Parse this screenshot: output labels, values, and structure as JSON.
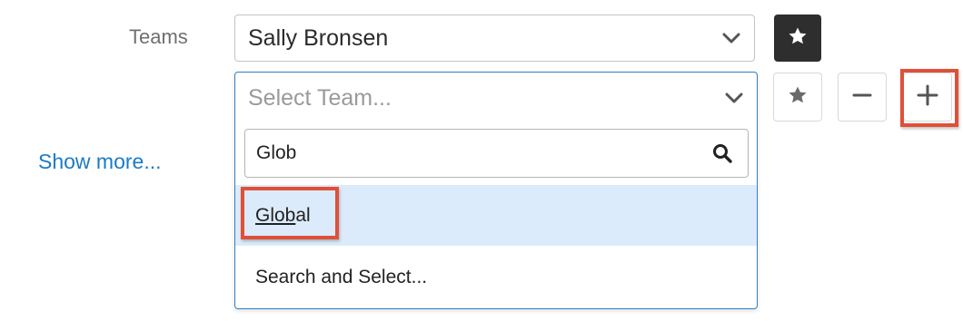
{
  "field": {
    "label": "Teams"
  },
  "primary_team": {
    "value": "Sally Bronsen"
  },
  "team_select": {
    "placeholder": "Select Team...",
    "search": {
      "value": "Glob",
      "placeholder": ""
    },
    "results": [
      {
        "match": "Glob",
        "rest": "al",
        "highlighted": true
      },
      {
        "label": "Search and Select..."
      }
    ]
  },
  "show_more": {
    "label": "Show more..."
  },
  "icons": {
    "primary_star": "star-icon",
    "row_star": "star-icon",
    "remove": "minus-icon",
    "add": "plus-icon",
    "search": "search-icon",
    "dropdown": "chevron-down-icon"
  },
  "colors": {
    "link": "#1a7bc7",
    "highlight_row": "#dcebfb",
    "callout": "#e05038",
    "primary_button": "#2e2e2e",
    "focus_border": "#2f80c4"
  }
}
